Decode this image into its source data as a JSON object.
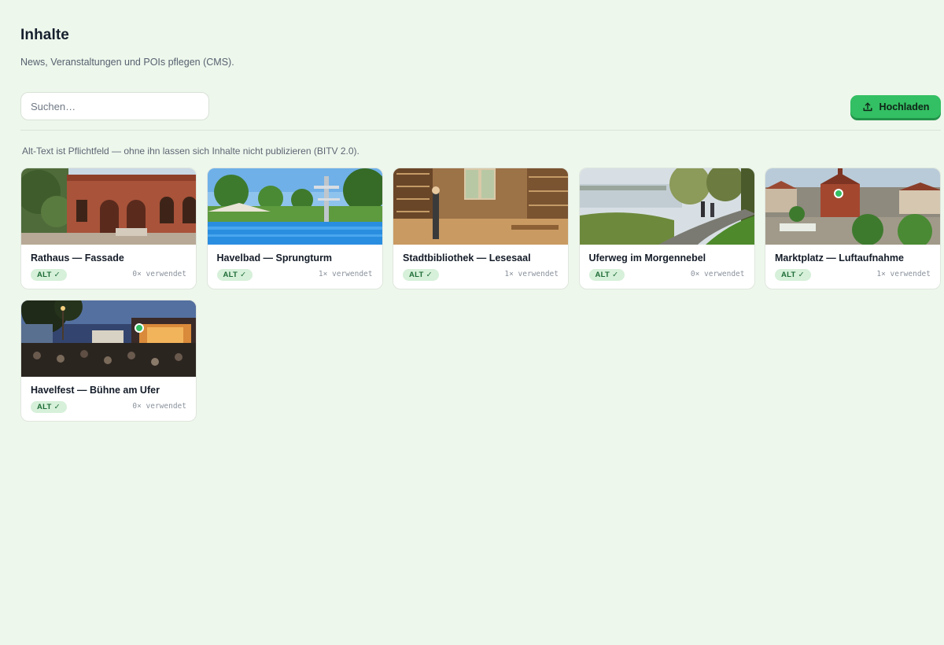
{
  "header": {
    "title": "Inhalte",
    "subtitle": "News, Veranstaltungen und POIs pflegen (CMS)."
  },
  "toolbar": {
    "search_placeholder": "Suchen…",
    "search_value": "",
    "upload_label": "Hochladen",
    "upload_icon": "upload-icon"
  },
  "hint": "Alt-Text ist Pflichtfeld — ohne ihn lassen sich Inhalte nicht publizieren (BITV 2.0).",
  "colors": {
    "background": "#eef7ec",
    "accent": "#33bf63",
    "badge_bg": "#d6f0d9",
    "badge_text": "#1d6b36"
  },
  "media": [
    {
      "title": "Rathaus — Fassade",
      "badge": "ALT ✓",
      "usage": "0× verwendet",
      "focus_marker": false
    },
    {
      "title": "Havelbad — Sprungturm",
      "badge": "ALT ✓",
      "usage": "1× verwendet",
      "focus_marker": false
    },
    {
      "title": "Stadtbibliothek — Lesesaal",
      "badge": "ALT ✓",
      "usage": "1× verwendet",
      "focus_marker": false
    },
    {
      "title": "Uferweg im Morgennebel",
      "badge": "ALT ✓",
      "usage": "0× verwendet",
      "focus_marker": false
    },
    {
      "title": "Marktplatz — Luftaufnahme",
      "badge": "ALT ✓",
      "usage": "1× verwendet",
      "focus_marker": true
    },
    {
      "title": "Havelfest — Bühne am Ufer",
      "badge": "ALT ✓",
      "usage": "0× verwendet",
      "focus_marker": true
    }
  ]
}
